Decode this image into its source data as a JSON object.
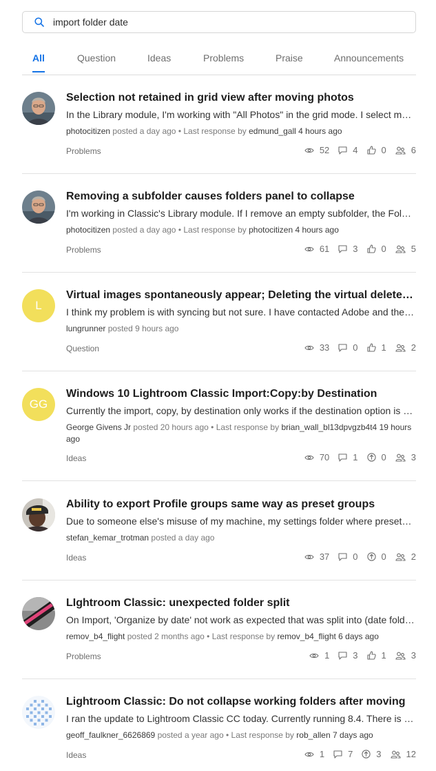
{
  "search": {
    "value": "import folder date"
  },
  "tabs": [
    {
      "label": "All"
    },
    {
      "label": "Question"
    },
    {
      "label": "Ideas"
    },
    {
      "label": "Problems"
    },
    {
      "label": "Praise"
    },
    {
      "label": "Announcements"
    }
  ],
  "active_tab": "All",
  "posts": [
    {
      "title": "Selection not retained in grid view after moving photos",
      "excerpt": "In the Library module, I'm working with \"All Photos\" in the grid mode. I select multiple photos and move them",
      "author": "photocitizen",
      "posted": "posted a day ago",
      "last_label": "• Last response by",
      "last_user": "edmund_gall",
      "last_time": "4 hours ago",
      "category": "Problems",
      "views": "52",
      "replies": "4",
      "vote_icon": "thumbs-up-icon",
      "votes": "0",
      "followers": "6",
      "avatar": "photo-man"
    },
    {
      "title": "Removing a subfolder causes folders panel to collapse",
      "excerpt": "I'm working in Classic's Library module. If I remove an empty subfolder, the Folders panel collapses",
      "author": "photocitizen",
      "posted": "posted a day ago",
      "last_label": "• Last response by",
      "last_user": "photocitizen",
      "last_time": "4 hours ago",
      "category": "Problems",
      "views": "61",
      "replies": "3",
      "vote_icon": "thumbs-up-icon",
      "votes": "0",
      "followers": "5",
      "avatar": "photo-man"
    },
    {
      "title": "Virtual images spontaneously appear; Deleting the virtual deletes the original",
      "excerpt": "I think my problem is with syncing but not sure. I have contacted Adobe and they could not help",
      "author": "lungrunner",
      "posted": "posted 9 hours ago",
      "last_label": "",
      "last_user": "",
      "last_time": "",
      "category": "Question",
      "views": "33",
      "replies": "0",
      "vote_icon": "thumbs-up-icon",
      "votes": "1",
      "followers": "2",
      "avatar": "initials",
      "initials": "L"
    },
    {
      "title": "Windows 10 Lightroom Classic Import:Copy:by Destination",
      "excerpt": "Currently the import, copy, by destination only works if the destination option is selected",
      "author": "George Givens Jr",
      "posted": "posted 20 hours ago",
      "last_label": "• Last response by",
      "last_user": "brian_wall_bl13dpvgzb4t4",
      "last_time": "19 hours ago",
      "category": "Ideas",
      "views": "70",
      "replies": "1",
      "vote_icon": "upvote-icon",
      "votes": "0",
      "followers": "3",
      "avatar": "initials",
      "initials": "GG"
    },
    {
      "title": "Ability to export Profile groups same way as preset groups",
      "excerpt": "Due to someone else's misuse of my machine, my settings folder where presets are stored was deleted",
      "author": "stefan_kemar_trotman",
      "posted": "posted a day ago",
      "last_label": "",
      "last_user": "",
      "last_time": "",
      "category": "Ideas",
      "views": "37",
      "replies": "0",
      "vote_icon": "upvote-icon",
      "votes": "0",
      "followers": "2",
      "avatar": "photo-cap"
    },
    {
      "title": "LIghtroom Classic: unexpected folder split",
      "excerpt": "On Import, 'Organize by date' not work as expected that was split into (date folders)",
      "author": "remov_b4_flight",
      "posted": "posted 2 months ago",
      "last_label": "• Last response by",
      "last_user": "remov_b4_flight",
      "last_time": "6 days ago",
      "category": "Problems",
      "views": "1",
      "replies": "3",
      "vote_icon": "thumbs-up-icon",
      "votes": "1",
      "followers": "3",
      "avatar": "photo-strap"
    },
    {
      "title": "Lightroom Classic: Do not collapse working folders after moving",
      "excerpt": "I ran the update to Lightroom Classic CC today. Currently running 8.4. There is a problem",
      "author": "geoff_faulkner_6626869",
      "posted": "posted a year ago",
      "last_label": "• Last response by",
      "last_user": "rob_allen",
      "last_time": "7 days ago",
      "category": "Ideas",
      "views": "1",
      "replies": "7",
      "vote_icon": "upvote-icon",
      "votes": "3",
      "followers": "12",
      "avatar": "pattern"
    }
  ]
}
